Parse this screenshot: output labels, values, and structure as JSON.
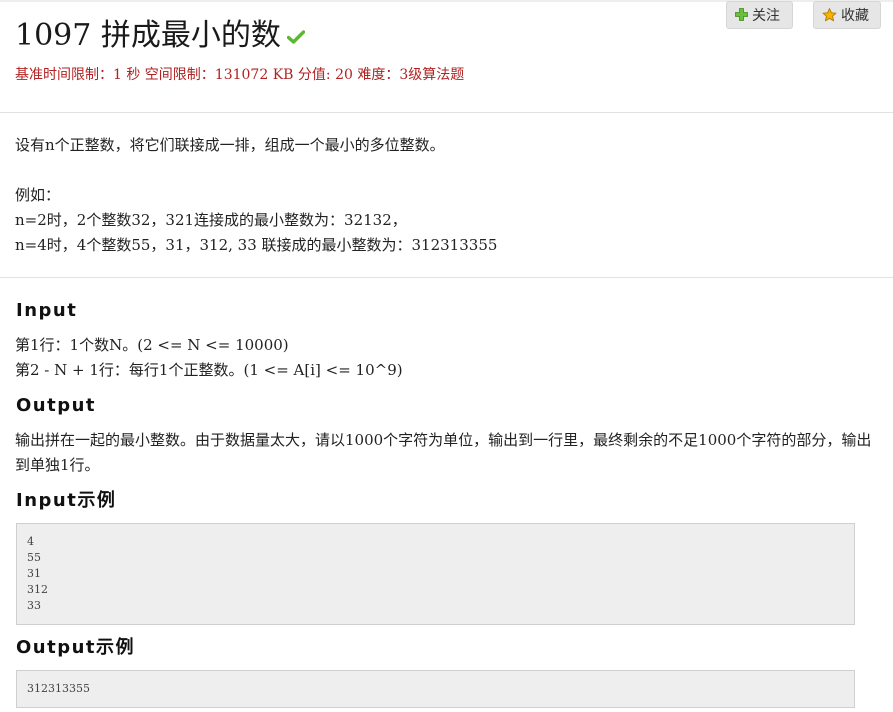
{
  "problem": {
    "title": "1097 拼成最小的数",
    "meta": "基准时间限制：1 秒 空间限制：131072 KB 分值: 20 难度：3级算法题",
    "status_icon": "check-icon",
    "status_color": "#5cb82e"
  },
  "actions": {
    "follow_label": "关注",
    "favorite_label": "收藏"
  },
  "description": {
    "intro": "设有n个正整数，将它们联接成一排，组成一个最小的多位整数。",
    "example_label": "例如：",
    "example_1": "n=2时，2个整数32，321连接成的最小整数为：32132，",
    "example_2": "n=4时，4个整数55，31，312, 33 联接成的最小整数为：312313355"
  },
  "input": {
    "heading": "Input",
    "line_1": "第1行：1个数N。(2 <= N <= 10000)",
    "line_2": "第2 - N + 1行：每行1个正整数。(1 <= A[i] <= 10^9)"
  },
  "output": {
    "heading": "Output",
    "text": "输出拼在一起的最小整数。由于数据量太大，请以1000个字符为单位，输出到一行里，最终剩余的不足1000个字符的部分，输出到单独1行。"
  },
  "input_example": {
    "heading": "Input示例",
    "lines": [
      "4",
      "55",
      "31",
      "312",
      "33"
    ]
  },
  "output_example": {
    "heading": "Output示例",
    "lines": [
      "312313355"
    ]
  }
}
